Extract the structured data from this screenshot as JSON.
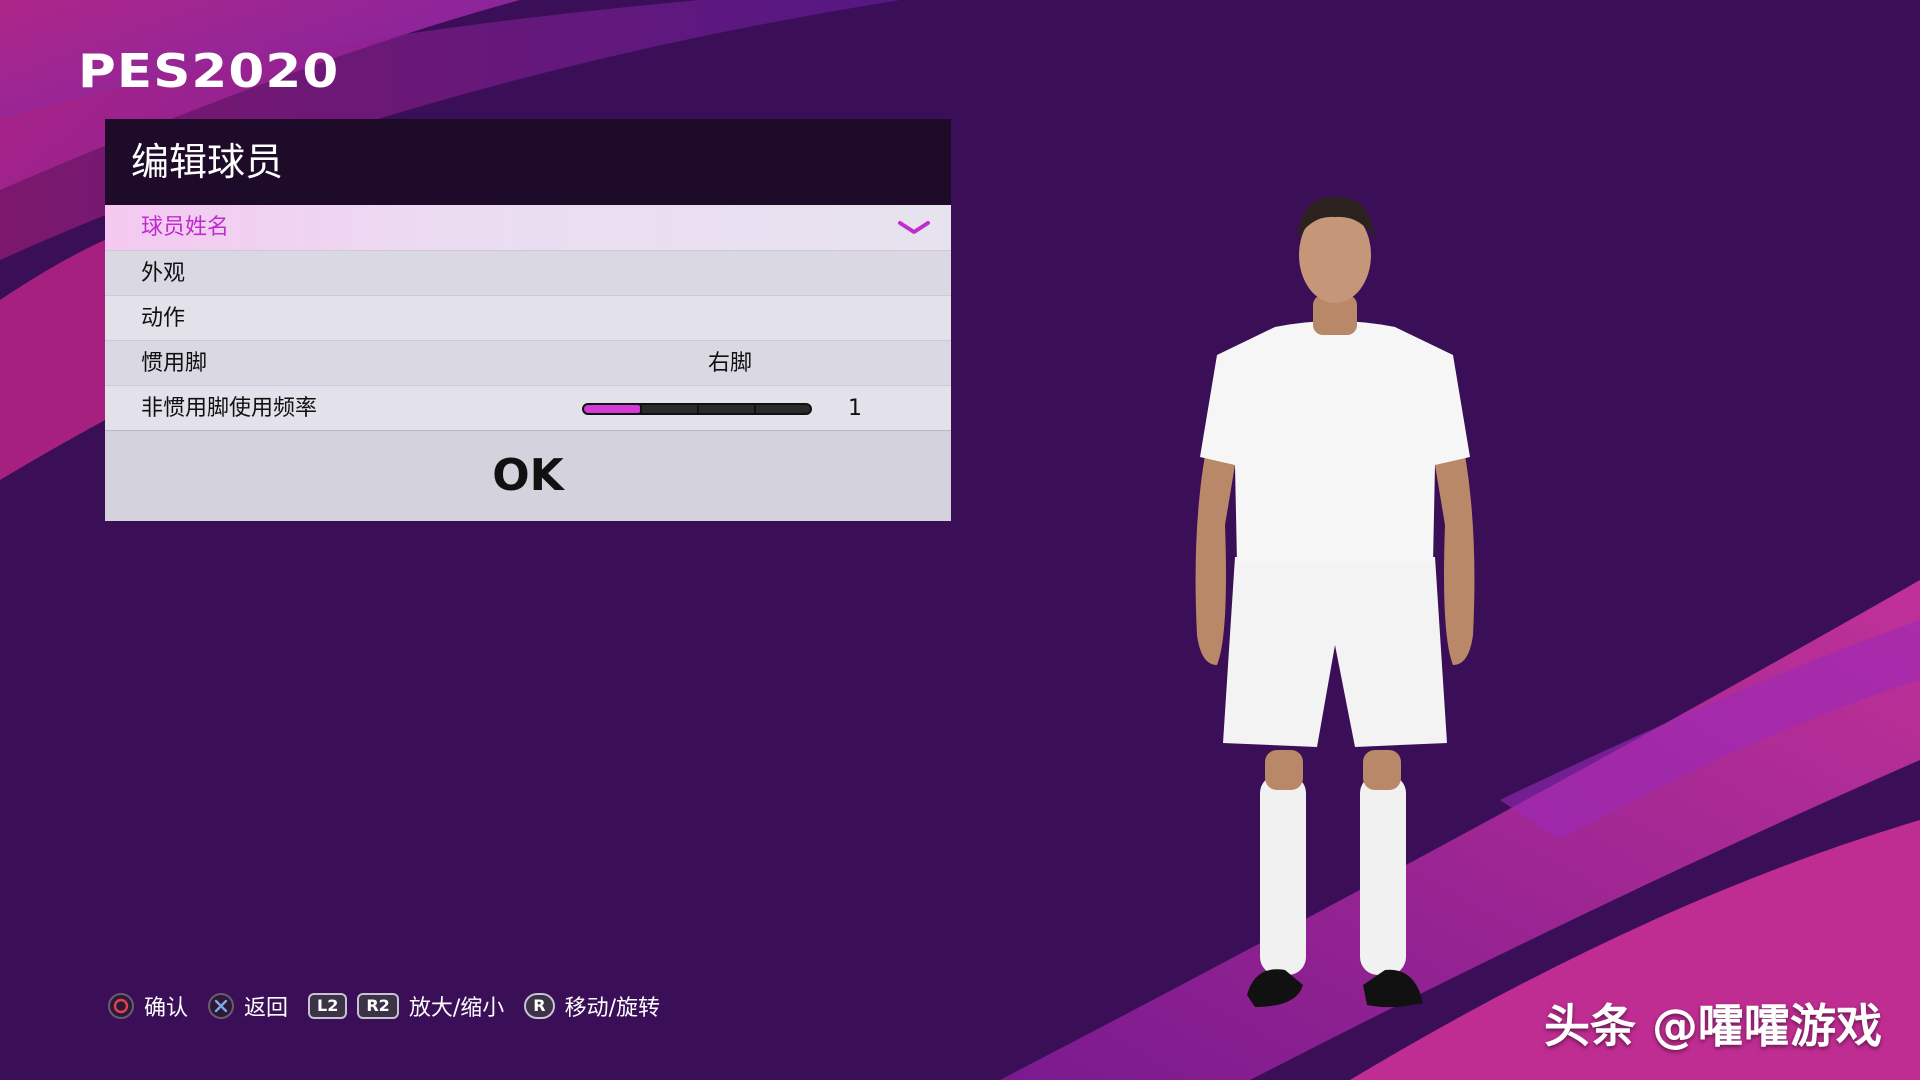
{
  "logo": "PES2020",
  "panel": {
    "title": "编辑球员",
    "rows": [
      {
        "label": "球员姓名"
      },
      {
        "label": "外观"
      },
      {
        "label": "动作"
      },
      {
        "label": "惯用脚",
        "value": "右脚"
      },
      {
        "label": "非惯用脚使用频率",
        "value": "1",
        "level_fraction": 0.25
      }
    ],
    "ok_label": "OK"
  },
  "controls": {
    "confirm": "确认",
    "back": "返回",
    "l2": "L2",
    "r2": "R2",
    "zoom": "放大/缩小",
    "r": "R",
    "move": "移动/旋转"
  },
  "watermark": "头条 @嚯嚯游戏",
  "colors": {
    "background": "#3b0f58",
    "accent": "#c12bd0",
    "panel_header": "#1e0b29"
  },
  "icons": [
    "circle-button-icon",
    "cross-button-icon",
    "chevron-down-icon"
  ]
}
